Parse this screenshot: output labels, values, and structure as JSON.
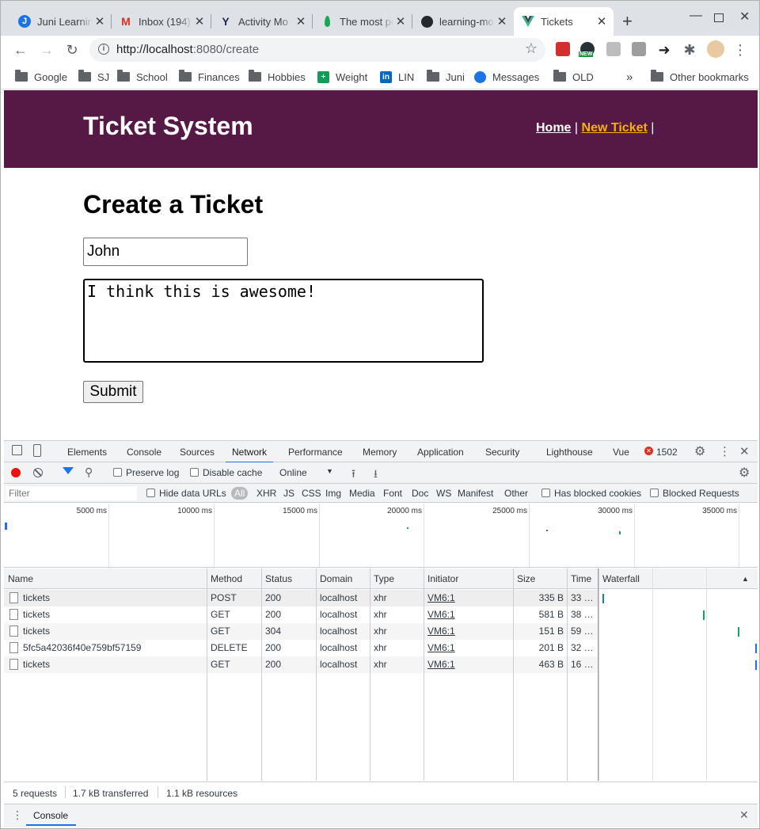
{
  "browser": {
    "tabs": [
      {
        "title": "Juni Learning",
        "icon": "juni-icon"
      },
      {
        "title": "Inbox (194)",
        "icon": "gmail-icon"
      },
      {
        "title": "Activity Mo",
        "icon": "yahoo-icon"
      },
      {
        "title": "The most po",
        "icon": "mongodb-icon"
      },
      {
        "title": "learning-mo",
        "icon": "github-icon"
      },
      {
        "title": "Tickets",
        "icon": "vue-icon"
      }
    ],
    "url_host": "http://localhost",
    "url_path": ":8080/create",
    "extension_badge": "NEW",
    "bookmarks": [
      "Google",
      "SJ",
      "School",
      "Finances",
      "Hobbies",
      "Weight",
      "LIN",
      "Juni",
      "Messages",
      "OLD"
    ],
    "bookmarks_overflow": "»",
    "other_bookmarks": "Other bookmarks"
  },
  "app": {
    "title": "Ticket System",
    "nav_home": "Home",
    "nav_sep": "|",
    "nav_new": "New Ticket",
    "heading": "Create a Ticket",
    "name_value": "John",
    "message_value": "I think this is awesome!",
    "submit_label": "Submit",
    "header_color": "#561845",
    "active_link_color": "#f5b301"
  },
  "devtools": {
    "tabs": [
      "Elements",
      "Console",
      "Sources",
      "Network",
      "Performance",
      "Memory",
      "Application",
      "Security",
      "Lighthouse",
      "Vue"
    ],
    "active_tab": "Network",
    "error_count": "1502",
    "preserve_log": "Preserve log",
    "disable_cache": "Disable cache",
    "throttle": "Online",
    "filter_placeholder": "Filter",
    "hide_data_urls": "Hide data URLs",
    "type_filters": [
      "All",
      "XHR",
      "JS",
      "CSS",
      "Img",
      "Media",
      "Font",
      "Doc",
      "WS",
      "Manifest",
      "Other"
    ],
    "has_blocked_cookies": "Has blocked cookies",
    "blocked_requests": "Blocked Requests",
    "timeline_ticks": [
      "5000 ms",
      "10000 ms",
      "15000 ms",
      "20000 ms",
      "25000 ms",
      "30000 ms",
      "35000 ms"
    ],
    "columns": [
      "Name",
      "Method",
      "Status",
      "Domain",
      "Type",
      "Initiator",
      "Size",
      "Time",
      "Waterfall"
    ],
    "rows": [
      {
        "name": "tickets",
        "method": "POST",
        "status": "200",
        "domain": "localhost",
        "type": "xhr",
        "initiator": "VM6:1",
        "size": "335 B",
        "time": "33 …"
      },
      {
        "name": "tickets",
        "method": "GET",
        "status": "200",
        "domain": "localhost",
        "type": "xhr",
        "initiator": "VM6:1",
        "size": "581 B",
        "time": "38 …"
      },
      {
        "name": "tickets",
        "method": "GET",
        "status": "304",
        "domain": "localhost",
        "type": "xhr",
        "initiator": "VM6:1",
        "size": "151 B",
        "time": "59 …"
      },
      {
        "name": "5fc5a42036f40e759bf57159",
        "method": "DELETE",
        "status": "200",
        "domain": "localhost",
        "type": "xhr",
        "initiator": "VM6:1",
        "size": "201 B",
        "time": "32 …"
      },
      {
        "name": "tickets",
        "method": "GET",
        "status": "200",
        "domain": "localhost",
        "type": "xhr",
        "initiator": "VM6:1",
        "size": "463 B",
        "time": "16 …"
      }
    ],
    "summary_requests": "5 requests",
    "summary_transferred": "1.7 kB transferred",
    "summary_resources": "1.1 kB resources",
    "drawer_tab": "Console"
  }
}
